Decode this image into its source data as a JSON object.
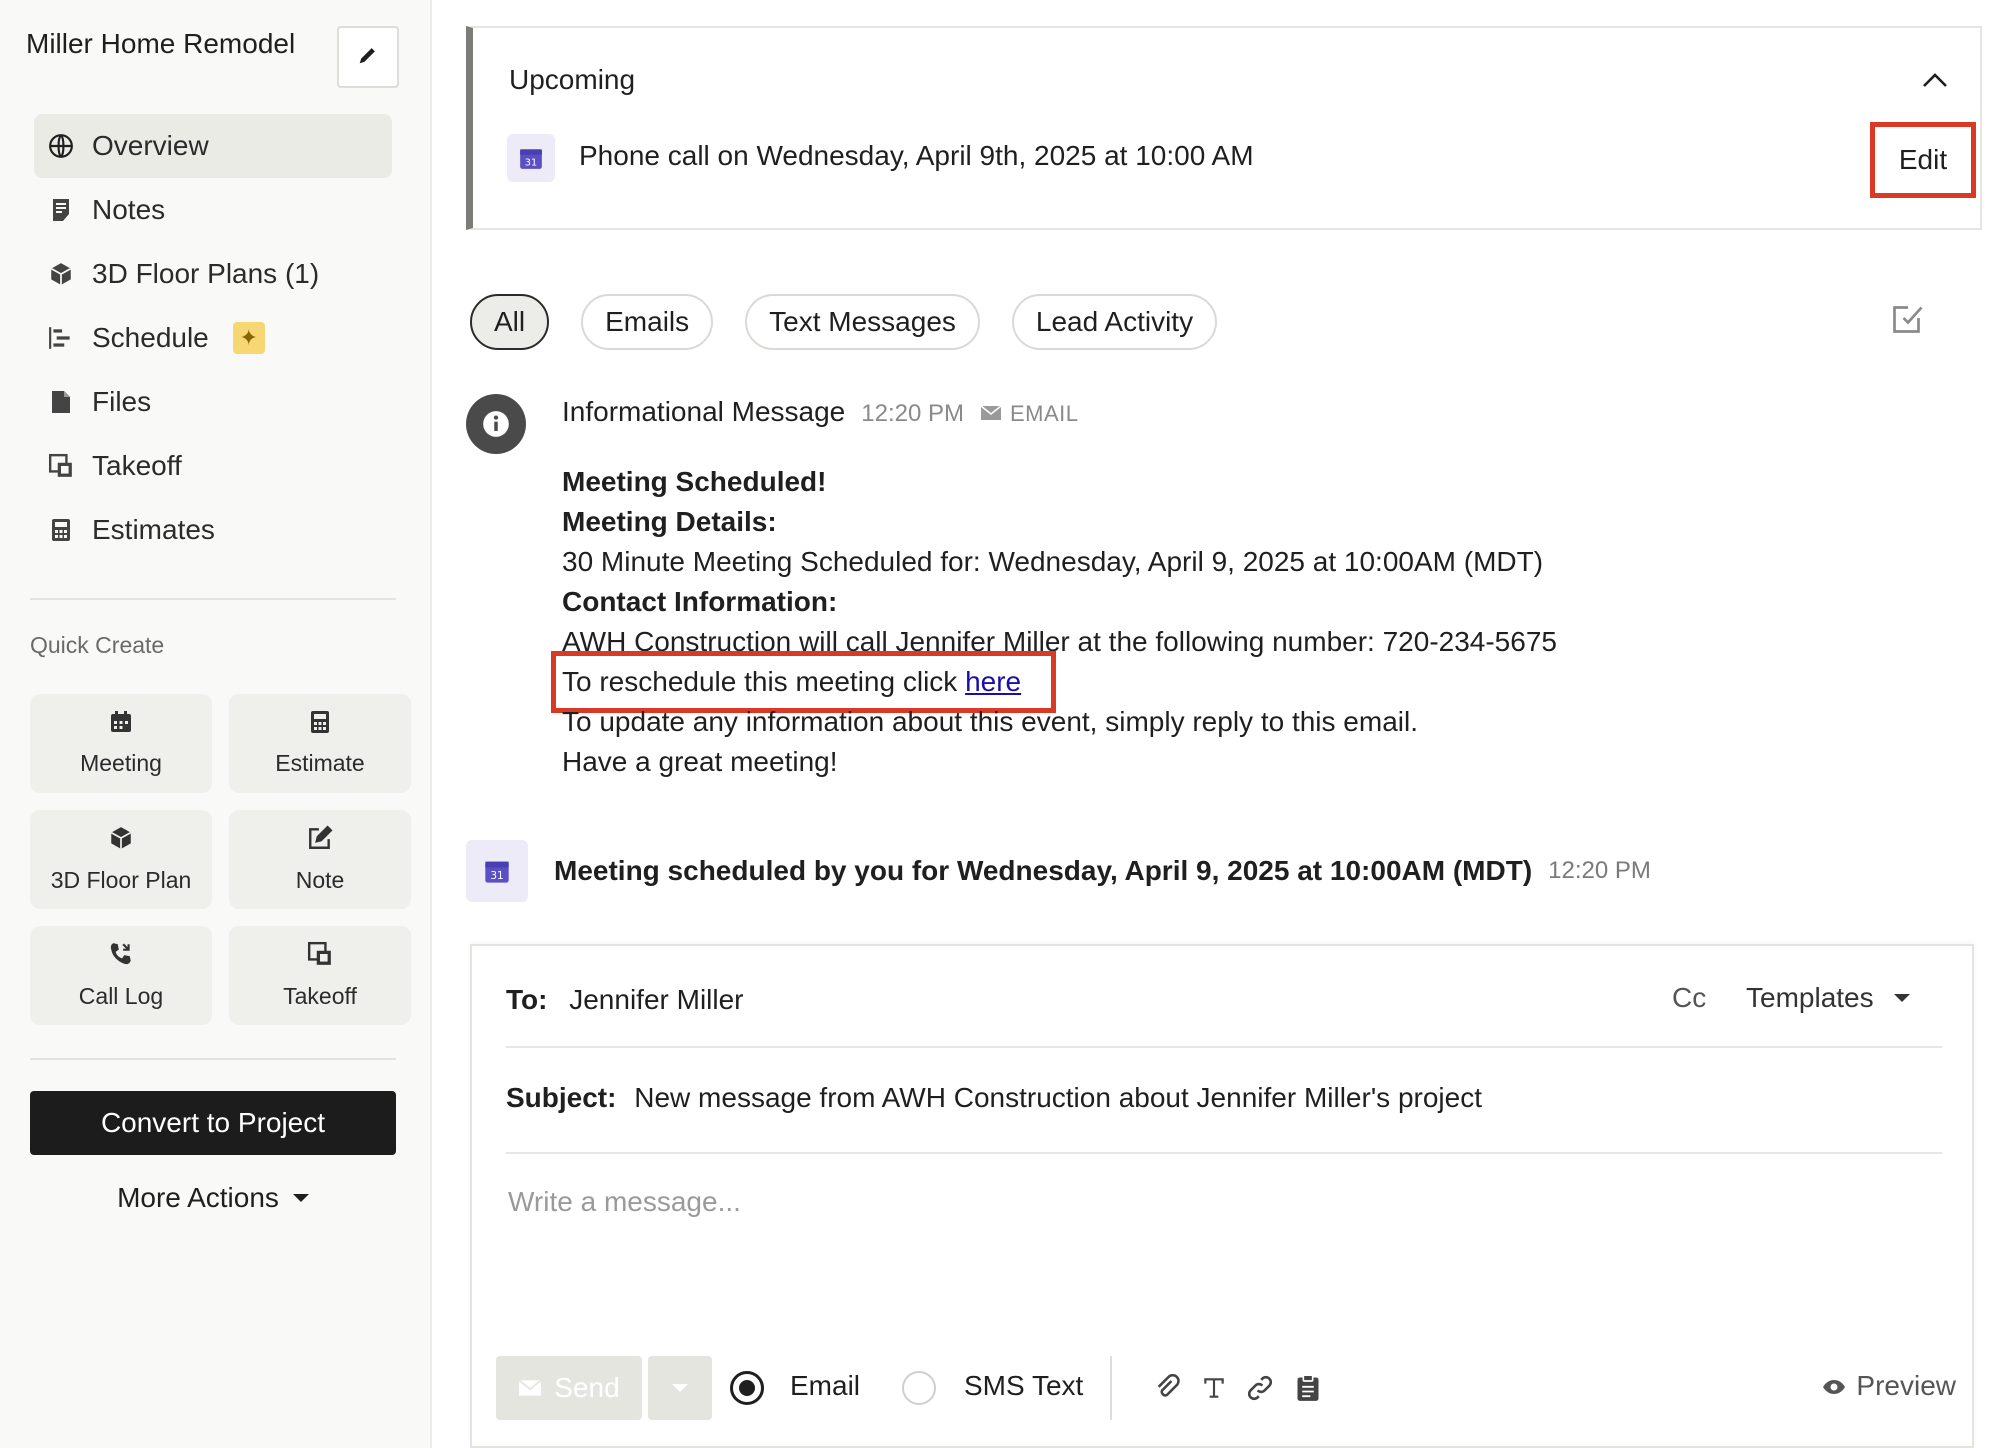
{
  "sidebar": {
    "project_title": "Miller Home Remodel",
    "nav": [
      {
        "label": "Overview",
        "icon": "globe-icon",
        "active": true
      },
      {
        "label": "Notes",
        "icon": "note-icon"
      },
      {
        "label": "3D Floor Plans (1)",
        "icon": "cube-icon"
      },
      {
        "label": "Schedule",
        "icon": "gantt-icon",
        "badge": "sparkle-icon"
      },
      {
        "label": "Files",
        "icon": "file-icon"
      },
      {
        "label": "Takeoff",
        "icon": "takeoff-icon"
      },
      {
        "label": "Estimates",
        "icon": "calculator-icon"
      }
    ],
    "quick_create_label": "Quick Create",
    "quick_create": [
      {
        "label": "Meeting",
        "icon": "calendar-icon"
      },
      {
        "label": "Estimate",
        "icon": "calculator-icon"
      },
      {
        "label": "3D Floor Plan",
        "icon": "cube-icon"
      },
      {
        "label": "Note",
        "icon": "edit-note-icon"
      },
      {
        "label": "Call Log",
        "icon": "phone-icon"
      },
      {
        "label": "Takeoff",
        "icon": "takeoff-icon"
      }
    ],
    "convert_label": "Convert to Project",
    "more_actions_label": "More Actions"
  },
  "upcoming": {
    "title": "Upcoming",
    "event_text": "Phone call on Wednesday, April 9th, 2025 at 10:00 AM",
    "calendar_day": "31",
    "edit_label": "Edit"
  },
  "filters": [
    "All",
    "Emails",
    "Text Messages",
    "Lead Activity"
  ],
  "message": {
    "title": "Informational Message",
    "time": "12:20 PM",
    "type": "EMAIL",
    "line1": "Meeting Scheduled!",
    "line2": "Meeting Details:",
    "line3": "30 Minute Meeting Scheduled for: Wednesday, April 9, 2025 at 10:00AM (MDT)",
    "line4": "Contact Information:",
    "line5": "AWH Construction will call Jennifer Miller at the following number: 720-234-5675",
    "line6_text": "To reschedule this meeting click ",
    "line6_link": "here",
    "line7": "To update any information about this event, simply reply to this email.",
    "line8": "Have a great meeting!"
  },
  "activity": {
    "text": "Meeting scheduled by you for Wednesday, April 9, 2025 at 10:00AM (MDT)",
    "time": "12:20 PM",
    "calendar_day": "31"
  },
  "composer": {
    "to_label": "To:",
    "to_value": "Jennifer Miller",
    "cc_label": "Cc",
    "templates_label": "Templates",
    "subject_label": "Subject:",
    "subject_value": "New message from AWH Construction about Jennifer Miller's project",
    "message_placeholder": "Write a message...",
    "send_label": "Send",
    "email_label": "Email",
    "sms_label": "SMS Text",
    "preview_label": "Preview",
    "selected_channel": "Email"
  },
  "colors": {
    "highlight": "#d93a26",
    "calendar_accent": "#5b4fc4",
    "sparkle_badge": "#f7d774",
    "primary_button": "#1c1c1c"
  }
}
